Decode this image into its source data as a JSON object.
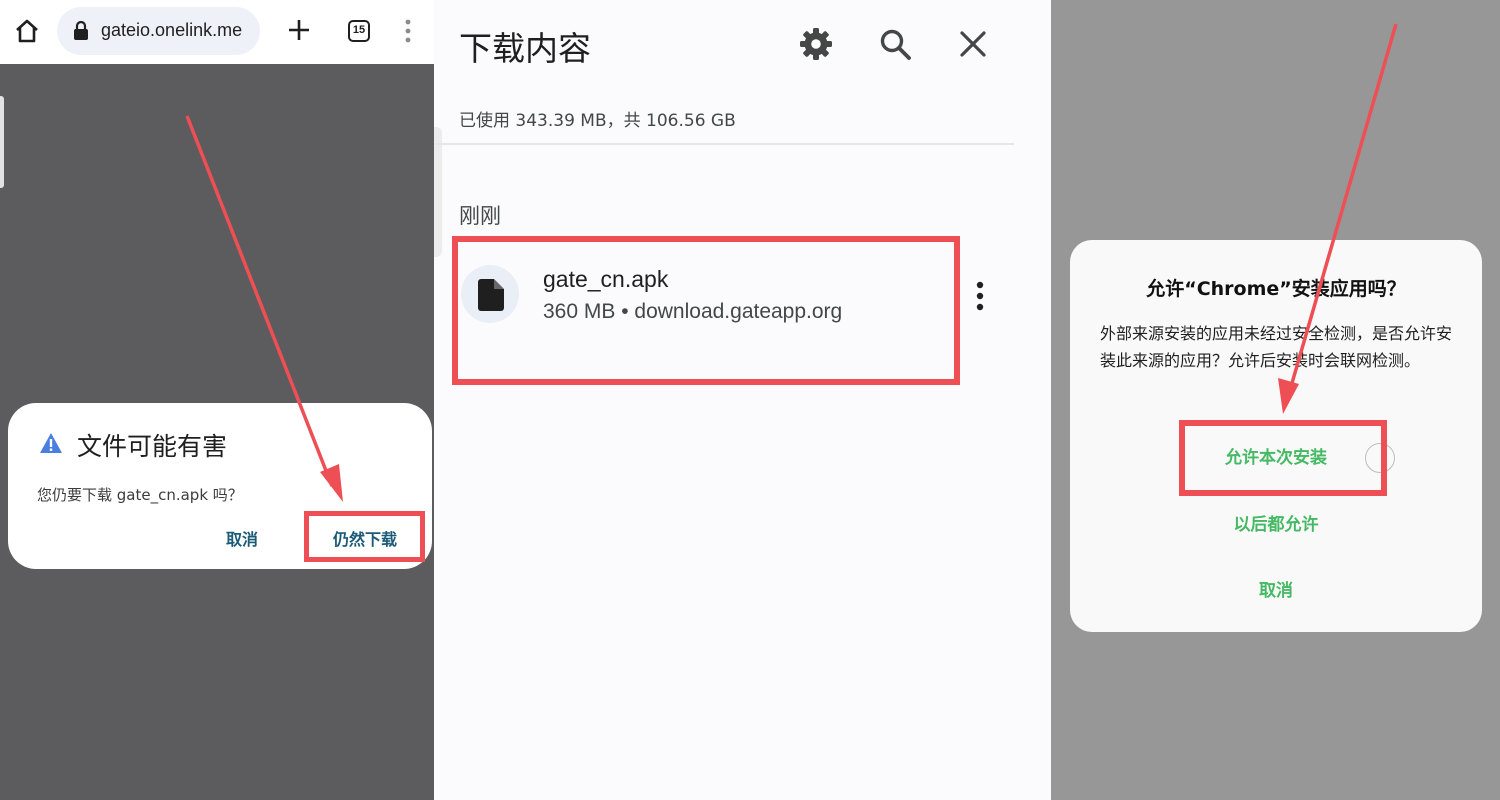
{
  "panel1": {
    "url": "gateio.onelink.me",
    "tab_count": "15",
    "dialog": {
      "title": "文件可能有害",
      "message": "您仍要下载 gate_cn.apk 吗？",
      "cancel": "取消",
      "keep": "仍然下载"
    }
  },
  "panel2": {
    "title": "下载内容",
    "storage": "已使用 343.39 MB，共 106.56 GB",
    "section": "刚刚",
    "file": {
      "name": "gate_cn.apk",
      "meta": "360 MB • download.gateapp.org"
    }
  },
  "panel3": {
    "dialog": {
      "title": "允许“Chrome”安装应用吗？",
      "body": "外部来源安装的应用未经过安全检测，是否允许安装此来源的应用？允许后安装时会联网检测。",
      "allow_once": "允许本次安装",
      "allow_always": "以后都允许",
      "cancel": "取消"
    }
  },
  "colors": {
    "highlight": "#ee4f55",
    "chrome_button": "#1b5b78",
    "install_option": "#45b963",
    "warning_icon": "#4a7fe0"
  }
}
